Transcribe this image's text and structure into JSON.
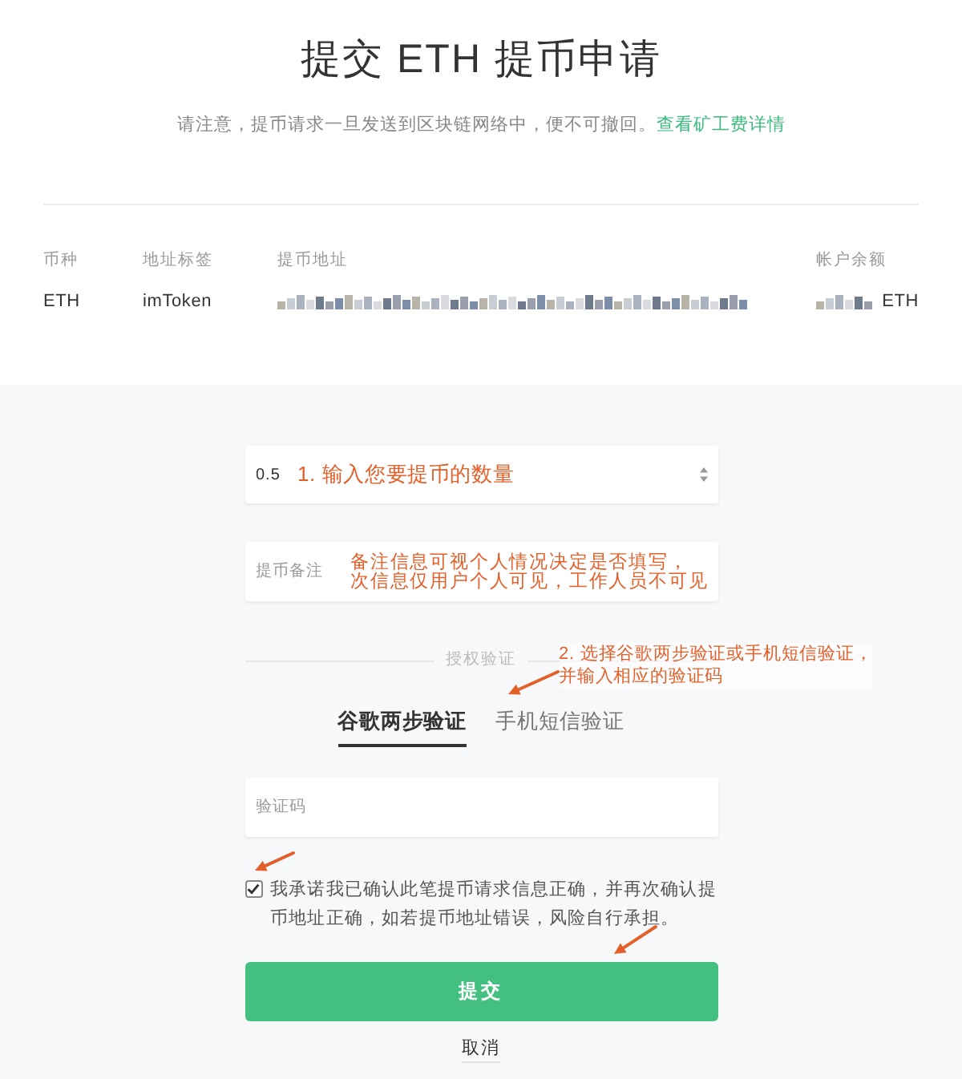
{
  "header": {
    "title": "提交 ETH 提币申请",
    "notice": "请注意，提币请求一旦发送到区块链网络中，便不可撤回。",
    "notice_link": "查看矿工费详情"
  },
  "details": {
    "columns": [
      "币种",
      "地址标签",
      "提币地址",
      "帐户余额"
    ],
    "row": [
      {
        "kind": "text",
        "text": "ETH"
      },
      {
        "kind": "text",
        "text": "imToken"
      },
      {
        "kind": "redacted"
      },
      {
        "kind": "redacted_amount",
        "unit": "ETH"
      }
    ]
  },
  "form": {
    "amount_field": {
      "value": "0.5",
      "annotation": "1. 输入您要提币的数量"
    },
    "remark_field": {
      "placeholder": "提币备注",
      "annotation": [
        "备注信息可视个人情况决定是否填写，",
        "次信息仅用户个人可见，工作人员不可见"
      ]
    },
    "verification": {
      "divider_label": "授权验证",
      "annotation": [
        "2. 选择谷歌两步验证或手机短信验证，",
        "并输入相应的验证码"
      ],
      "tabs": [
        {
          "label": "谷歌两步验证",
          "selected": true
        },
        {
          "label": "手机短信验证",
          "selected": false
        }
      ],
      "code_field": {
        "placeholder": "验证码"
      }
    },
    "agreement": {
      "checked": true,
      "text": "我承诺我已确认此笔提币请求信息正确，并再次确认提币地址正确，如若提币地址错误，风险自行承担。"
    },
    "submit_button": "提交",
    "cancel_button": "取消"
  }
}
